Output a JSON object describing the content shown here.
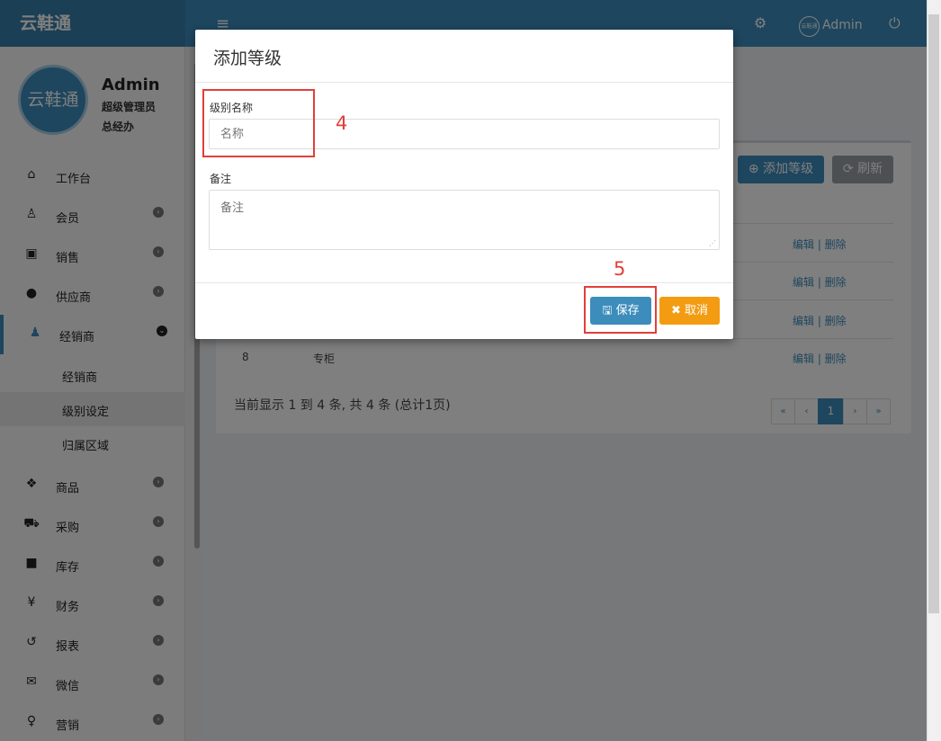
{
  "header": {
    "logo": "云鞋通",
    "menu_icon": "≡",
    "settings_icon": "⚙",
    "avatar_text": "云鞋通",
    "user_name": "Admin",
    "power_icon": "⏻"
  },
  "sidebar": {
    "avatar_text": "云鞋通",
    "user_name": "Admin",
    "user_role": "超级管理员",
    "user_dept": "总经办",
    "items": [
      {
        "label": "工作台",
        "icon": "⌂"
      },
      {
        "label": "会员",
        "icon": "♙"
      },
      {
        "label": "销售",
        "icon": "▣"
      },
      {
        "label": "供应商",
        "icon": "●"
      },
      {
        "label": "经销商",
        "icon": "♟"
      },
      {
        "label": "商品",
        "icon": "❖"
      },
      {
        "label": "采购",
        "icon": "⛟"
      },
      {
        "label": "库存",
        "icon": "■"
      },
      {
        "label": "财务",
        "icon": "¥"
      },
      {
        "label": "报表",
        "icon": "↺"
      },
      {
        "label": "微信",
        "icon": "✉"
      },
      {
        "label": "营销",
        "icon": "♀"
      }
    ],
    "sub_items": [
      {
        "label": "经销商"
      },
      {
        "label": "级别设定"
      },
      {
        "label": "归属区域"
      }
    ]
  },
  "toolbar": {
    "add_label": "添加等级",
    "refresh_label": "刷新"
  },
  "table": {
    "rows": [
      {
        "id": "",
        "name": "",
        "actions": "编辑 | 删除"
      },
      {
        "id": "",
        "name": "",
        "actions": "编辑 | 删除"
      },
      {
        "id": "",
        "name": "",
        "actions": "编辑 | 删除"
      },
      {
        "id": "8",
        "name": "专柜",
        "actions": "编辑 | 删除"
      }
    ]
  },
  "pagination": {
    "info": "当前显示 1 到 4 条, 共 4 条 (总计1页)",
    "first": "«",
    "prev": "‹",
    "current": "1",
    "next": "›",
    "last": "»"
  },
  "modal": {
    "title": "添加等级",
    "name_label": "级别名称",
    "name_placeholder": "名称",
    "remark_label": "备注",
    "remark_placeholder": "备注",
    "save_label": "保存",
    "cancel_label": "取消"
  },
  "annotations": {
    "step_4": "4",
    "step_5": "5"
  },
  "colors": {
    "primary": "#3c8dbc",
    "warning": "#f39c12",
    "annotation": "#e0403a"
  }
}
